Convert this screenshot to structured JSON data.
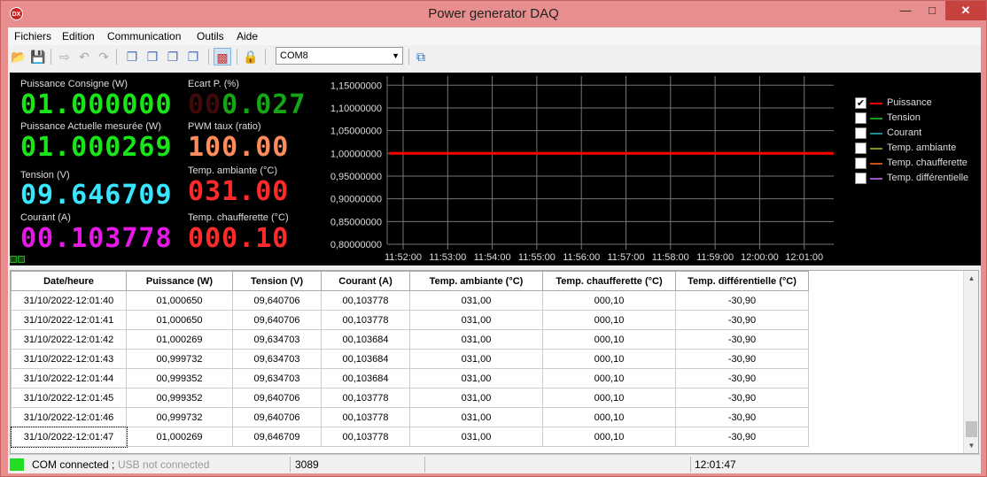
{
  "window": {
    "title": "Power generator DAQ",
    "icon_text": "DX"
  },
  "menu": [
    "Fichiers",
    "Edition",
    "Communication",
    "Outils",
    "Aide"
  ],
  "toolbar": {
    "com_port": "COM8"
  },
  "readouts": {
    "puissance_consigne": {
      "label": "Puissance Consigne (W)",
      "value": "01.000000",
      "color": "#19e619"
    },
    "ecart_p": {
      "label": "Ecart P. (%)",
      "value": "0.027",
      "ghost": "00",
      "color": "#14a614"
    },
    "puissance_actuelle": {
      "label": "Puissance Actuelle mesurée (W)",
      "value": "01.000269",
      "color": "#19e619"
    },
    "pwm_taux": {
      "label": "PWM taux (ratio)",
      "value": "100.00",
      "color": "#ff8c5a"
    },
    "tension": {
      "label": "Tension (V)",
      "value": "09.646709",
      "color": "#39e6ff"
    },
    "temp_ambiante": {
      "label": "Temp. ambiante (°C)",
      "value": "031.00",
      "color": "#ff2a2a"
    },
    "courant": {
      "label": "Courant (A)",
      "value": "00.103778",
      "color": "#e619e6"
    },
    "temp_chaufferette": {
      "label": "Temp. chaufferette (°C)",
      "value": "000.10",
      "color": "#ff2a2a"
    }
  },
  "chart_data": {
    "type": "line",
    "x_labels": [
      "11:52:00",
      "11:53:00",
      "11:54:00",
      "11:55:00",
      "11:56:00",
      "11:57:00",
      "11:58:00",
      "11:59:00",
      "12:00:00",
      "12:01:00"
    ],
    "y_labels": [
      "0,80000000",
      "0,85000000",
      "0,90000000",
      "0,95000000",
      "1,00000000",
      "1,05000000",
      "1,10000000",
      "1,15000000"
    ],
    "ylim": [
      0.8,
      1.17
    ],
    "grid": true,
    "series": [
      {
        "name": "Puissance",
        "value": 1.0,
        "color": "#ff0000"
      }
    ]
  },
  "legend": [
    {
      "name": "Puissance",
      "color": "#ff0000",
      "checked": true
    },
    {
      "name": "Tension",
      "color": "#14a014",
      "checked": false
    },
    {
      "name": "Courant",
      "color": "#1e8c8c",
      "checked": false
    },
    {
      "name": "Temp. ambiante",
      "color": "#8c8c14",
      "checked": false
    },
    {
      "name": "Temp. chaufferette",
      "color": "#c85014",
      "checked": false
    },
    {
      "name": "Temp. différentielle",
      "color": "#a050c8",
      "checked": false
    }
  ],
  "table": {
    "headers": [
      "Date/heure",
      "Puissance (W)",
      "Tension (V)",
      "Courant (A)",
      "Temp. ambiante (°C)",
      "Temp. chaufferette (°C)",
      "Temp. différentielle (°C)"
    ],
    "rows": [
      [
        "31/10/2022-12:01:40",
        "01,000650",
        "09,640706",
        "00,103778",
        "031,00",
        "000,10",
        "-30,90"
      ],
      [
        "31/10/2022-12:01:41",
        "01,000650",
        "09,640706",
        "00,103778",
        "031,00",
        "000,10",
        "-30,90"
      ],
      [
        "31/10/2022-12:01:42",
        "01,000269",
        "09,634703",
        "00,103684",
        "031,00",
        "000,10",
        "-30,90"
      ],
      [
        "31/10/2022-12:01:43",
        "00,999732",
        "09,634703",
        "00,103684",
        "031,00",
        "000,10",
        "-30,90"
      ],
      [
        "31/10/2022-12:01:44",
        "00,999352",
        "09,634703",
        "00,103684",
        "031,00",
        "000,10",
        "-30,90"
      ],
      [
        "31/10/2022-12:01:45",
        "00,999352",
        "09,640706",
        "00,103778",
        "031,00",
        "000,10",
        "-30,90"
      ],
      [
        "31/10/2022-12:01:46",
        "00,999732",
        "09,640706",
        "00,103778",
        "031,00",
        "000,10",
        "-30,90"
      ],
      [
        "31/10/2022-12:01:47",
        "01,000269",
        "09,646709",
        "00,103778",
        "031,00",
        "000,10",
        "-30,90"
      ]
    ]
  },
  "status": {
    "com": "COM connected ;",
    "usb": "USB not connected",
    "count": "3089",
    "time": "12:01:47",
    "indicator_color": "#22dd22"
  }
}
